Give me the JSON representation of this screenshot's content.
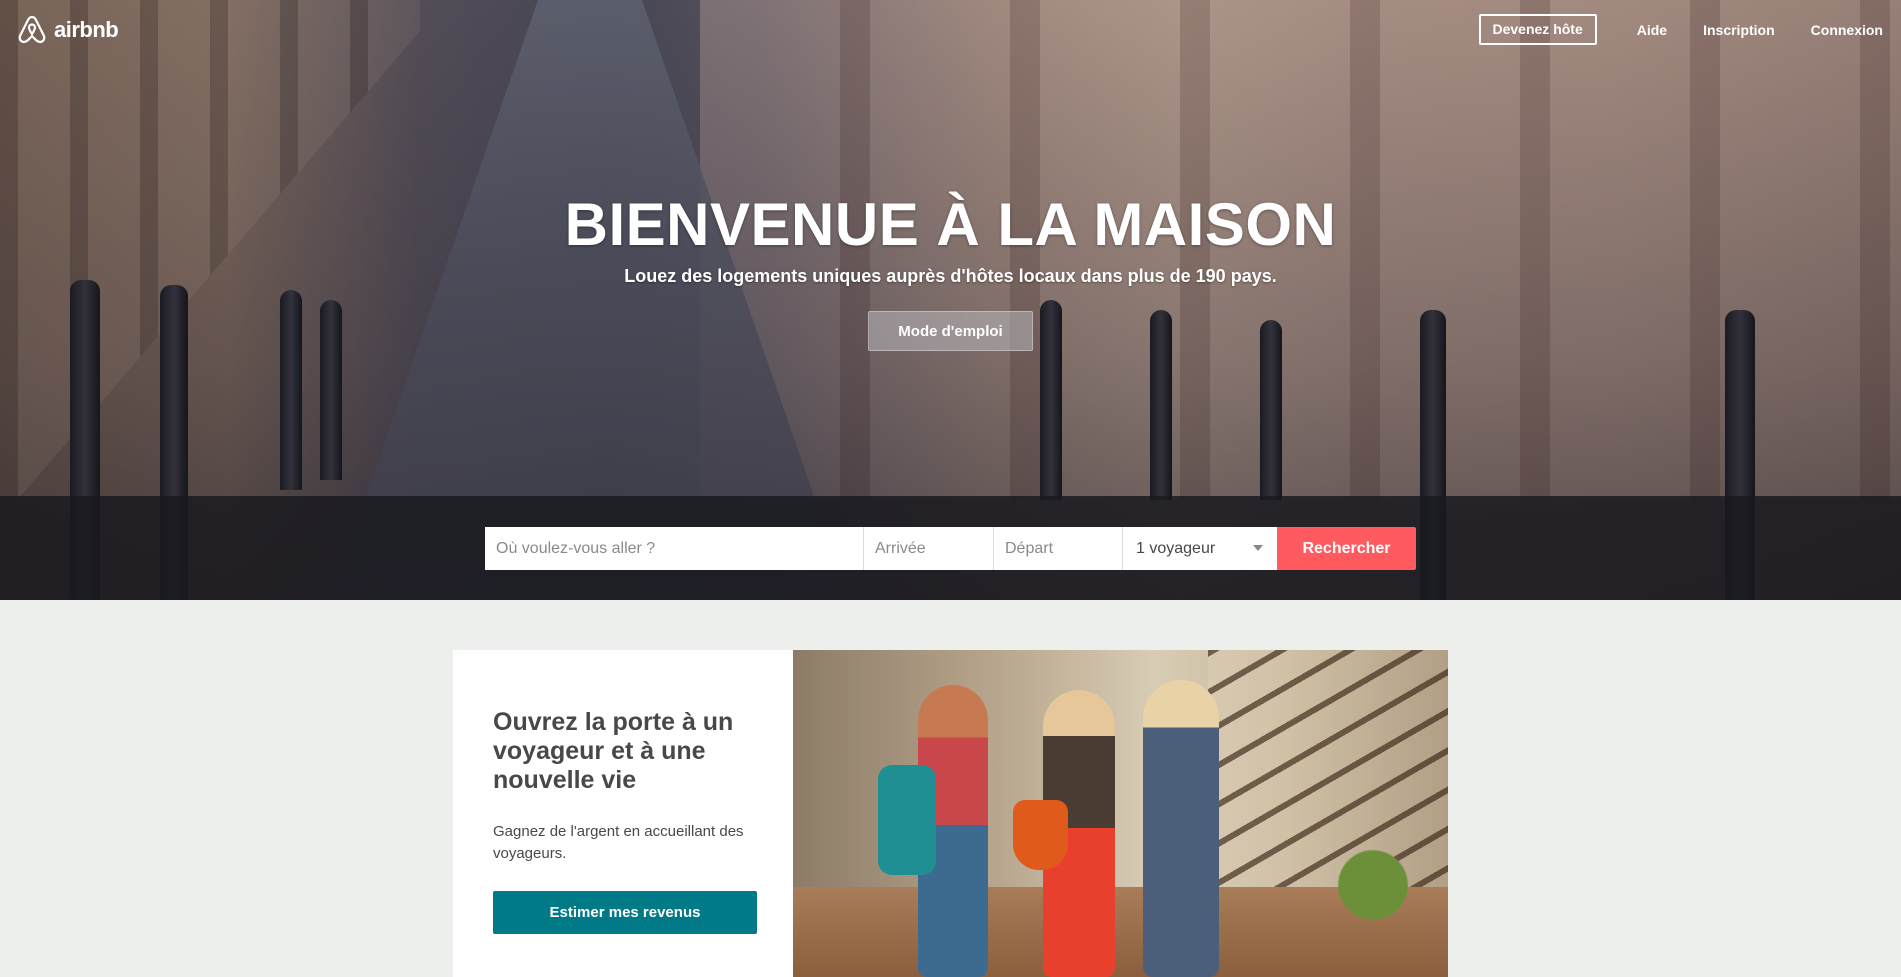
{
  "brand": {
    "name": "airbnb",
    "color": "#ff5a5f"
  },
  "nav": {
    "become_host": "Devenez hôte",
    "help": "Aide",
    "signup": "Inscription",
    "login": "Connexion"
  },
  "hero": {
    "title": "BIENVENUE À LA MAISON",
    "subtitle": "Louez des logements uniques auprès d'hôtes locaux dans plus de 190 pays.",
    "howto_label": "Mode d'emploi"
  },
  "search": {
    "where_placeholder": "Où voulez-vous aller ?",
    "checkin_placeholder": "Arrivée",
    "checkout_placeholder": "Départ",
    "guests_value": "1 voyageur",
    "submit_label": "Rechercher"
  },
  "host_promo": {
    "heading": "Ouvrez la porte à un voyageur et à une nouvelle vie",
    "text": "Gagnez de l'argent en accueillant des voyageurs.",
    "button_label": "Estimer mes revenus",
    "button_color": "#007a87"
  }
}
